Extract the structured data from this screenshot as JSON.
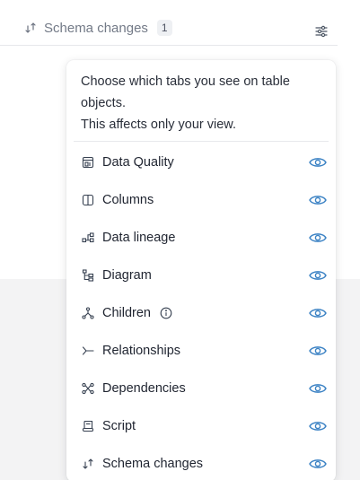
{
  "tab_bar": {
    "active_tab": {
      "icon": "schema-changes-icon",
      "label": "Schema changes",
      "badge": "1"
    },
    "settings_icon": "sliders-icon"
  },
  "popover": {
    "description_line1": "Choose which tabs you see on table objects.",
    "description_line2": "This affects only your view.",
    "items": [
      {
        "label": "Data Quality",
        "icon": "data-quality-icon",
        "visible": true
      },
      {
        "label": "Columns",
        "icon": "columns-icon",
        "visible": true
      },
      {
        "label": "Data lineage",
        "icon": "data-lineage-icon",
        "visible": true
      },
      {
        "label": "Diagram",
        "icon": "diagram-icon",
        "visible": true
      },
      {
        "label": "Children",
        "icon": "children-icon",
        "visible": true,
        "has_info": true
      },
      {
        "label": "Relationships",
        "icon": "relationships-icon",
        "visible": true
      },
      {
        "label": "Dependencies",
        "icon": "dependencies-icon",
        "visible": true
      },
      {
        "label": "Script",
        "icon": "script-icon",
        "visible": true
      },
      {
        "label": "Schema changes",
        "icon": "schema-changes-icon",
        "visible": true
      }
    ]
  },
  "colors": {
    "accent": "#3b82c4",
    "muted_text": "#737a87",
    "text": "#1f2430"
  }
}
